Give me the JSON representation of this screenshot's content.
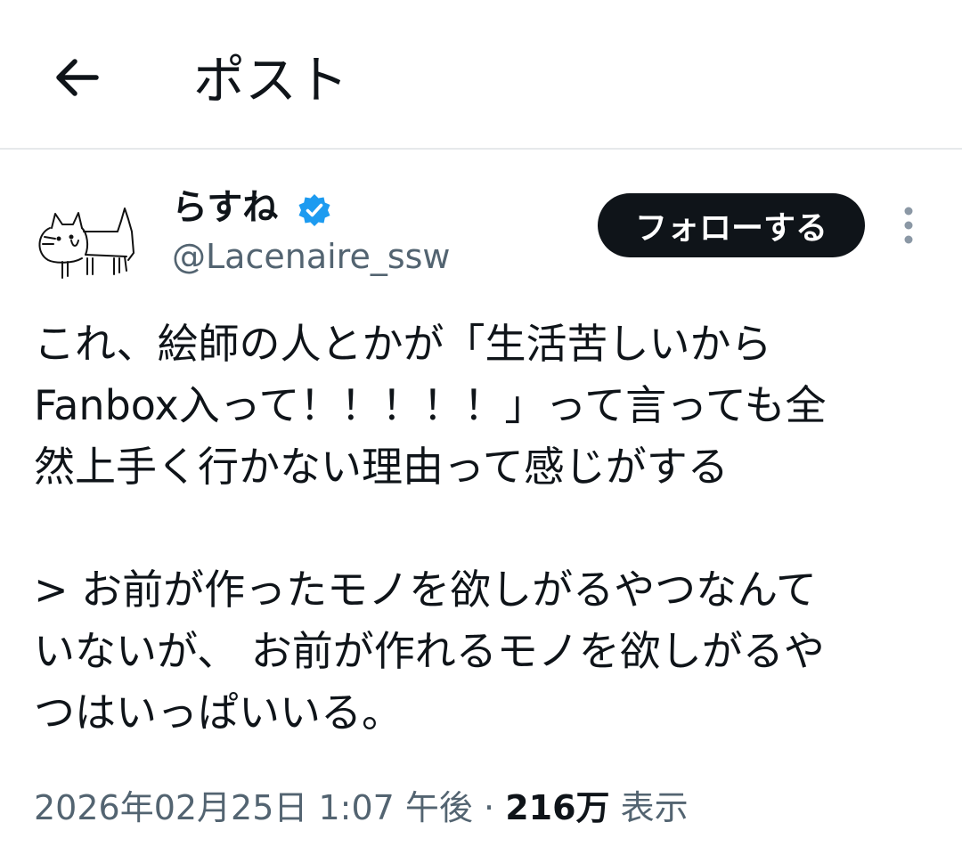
{
  "header": {
    "back_icon": "arrow-left-icon",
    "title": "ポスト"
  },
  "author": {
    "display_name": "らすね",
    "verified_icon": "verified-badge-icon",
    "verified_color": "#1d9bf0",
    "handle": "@Lacenaire_ssw",
    "avatar_icon": "cat-doodle-avatar"
  },
  "actions": {
    "follow_label": "フォローする",
    "more_icon": "more-vertical-icon"
  },
  "post": {
    "text": "これ、絵師の人とかが「生活苦しいから\nFanbox入って！！！！！」って言っても全\n然上手く行かない理由って感じがする\n\n> お前が作ったモノを欲しがるやつなんて\nいないが、 お前が作れるモノを欲しがるや\nつはいっぱいいる。"
  },
  "meta": {
    "timestamp": "2026年02月25日 1:07 午後",
    "separator": "·",
    "views_count": "216万",
    "views_label": "表示"
  },
  "colors": {
    "text": "#0f1419",
    "secondary": "#536471",
    "button_bg": "#0f1419",
    "divider": "#e6e9eb"
  }
}
